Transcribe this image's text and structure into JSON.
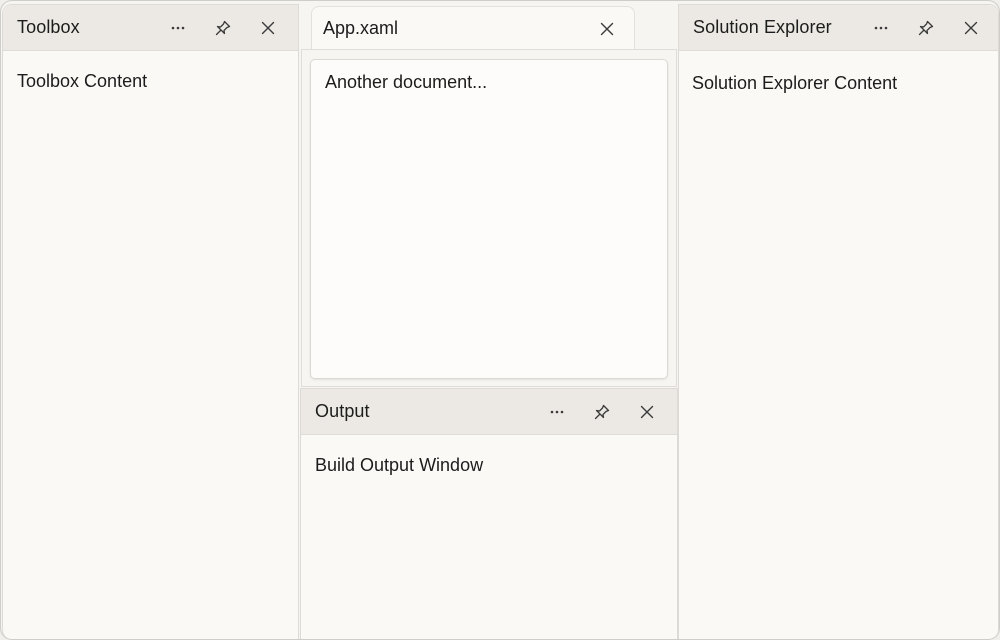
{
  "panes": {
    "toolbox": {
      "title": "Toolbox",
      "content": "Toolbox Content"
    },
    "solution_explorer": {
      "title": "Solution Explorer",
      "content": "Solution Explorer Content"
    },
    "output": {
      "title": "Output",
      "content": "Build Output Window"
    }
  },
  "document": {
    "tab_label": "App.xaml",
    "content": "Another document..."
  },
  "icons": {
    "more": "more-options-icon",
    "pin": "pin-icon",
    "close": "close-icon"
  },
  "colors": {
    "background": "#f7f5f2",
    "header": "#ece9e4",
    "border": "#dedbd6"
  }
}
